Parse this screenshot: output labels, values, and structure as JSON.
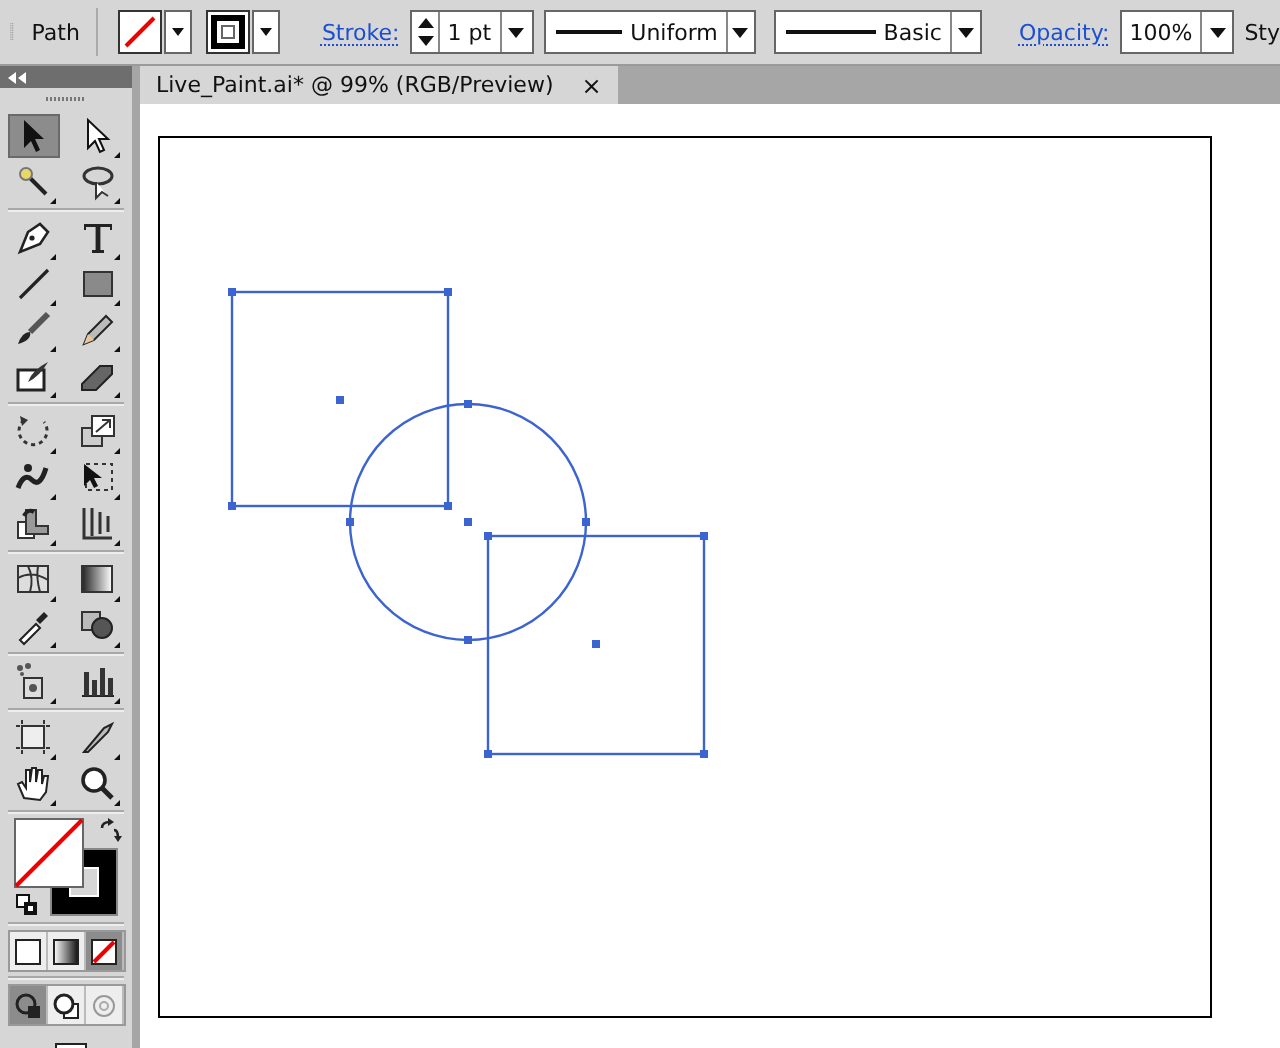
{
  "control_bar": {
    "selection_label": "Path",
    "stroke_label": "Stroke:",
    "stroke_weight": "1 pt",
    "variable_width_profile": "Uniform",
    "brush_definition": "Basic",
    "opacity_label": "Opacity:",
    "opacity": "100%",
    "style_label": "Sty"
  },
  "document_tab": {
    "title": "Live_Paint.ai* @ 99% (RGB/Preview)",
    "close": "×"
  },
  "tool_groups": [
    [
      {
        "kind": "selection",
        "selected": true
      },
      {
        "kind": "direct-selection",
        "selected": false
      },
      {
        "kind": "magic-wand",
        "selected": false
      },
      {
        "kind": "lasso",
        "selected": false
      }
    ],
    [
      {
        "kind": "pen",
        "selected": false
      },
      {
        "kind": "type",
        "selected": false
      },
      {
        "kind": "line",
        "selected": false
      },
      {
        "kind": "rectangle",
        "selected": false
      },
      {
        "kind": "paintbrush",
        "selected": false
      },
      {
        "kind": "pencil",
        "selected": false
      },
      {
        "kind": "blob-brush",
        "selected": false
      },
      {
        "kind": "eraser",
        "selected": false
      }
    ],
    [
      {
        "kind": "rotate",
        "selected": false
      },
      {
        "kind": "scale",
        "selected": false
      },
      {
        "kind": "warp",
        "selected": false
      },
      {
        "kind": "free-transform",
        "selected": false
      },
      {
        "kind": "shape-builder",
        "selected": false
      },
      {
        "kind": "perspective",
        "selected": false
      }
    ],
    [
      {
        "kind": "mesh",
        "selected": false
      },
      {
        "kind": "gradient",
        "selected": false
      },
      {
        "kind": "eyedropper",
        "selected": false
      },
      {
        "kind": "blend",
        "selected": false
      }
    ],
    [
      {
        "kind": "symbol-sprayer",
        "selected": false
      },
      {
        "kind": "column-graph",
        "selected": false
      }
    ],
    [
      {
        "kind": "artboard",
        "selected": false
      },
      {
        "kind": "slice",
        "selected": false
      },
      {
        "kind": "hand",
        "selected": false
      },
      {
        "kind": "zoom",
        "selected": false
      }
    ]
  ],
  "color_modes": [
    {
      "kind": "color",
      "selected": false
    },
    {
      "kind": "gradient",
      "selected": false
    },
    {
      "kind": "none",
      "selected": true
    }
  ],
  "draw_modes": [
    {
      "kind": "normal",
      "selected": true
    },
    {
      "kind": "behind",
      "selected": false
    },
    {
      "kind": "inside",
      "selected": false
    }
  ]
}
